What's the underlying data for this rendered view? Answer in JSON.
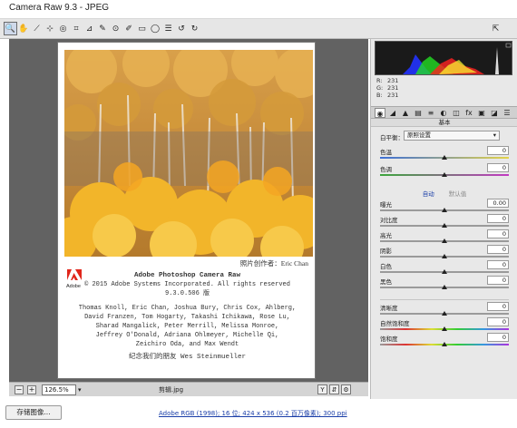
{
  "window": {
    "title": "Camera Raw 9.3 - JPEG"
  },
  "toolbar": {
    "tools": [
      {
        "icon": "zoom-icon",
        "glyph": "🔍",
        "active": true
      },
      {
        "icon": "hand-icon",
        "glyph": "✋",
        "active": false
      },
      {
        "icon": "white-balance-icon",
        "glyph": "⟋",
        "active": false
      },
      {
        "icon": "color-sampler-icon",
        "glyph": "⊹",
        "active": false
      },
      {
        "icon": "target-adjust-icon",
        "glyph": "◎",
        "active": false
      },
      {
        "icon": "crop-icon",
        "glyph": "⌗",
        "active": false
      },
      {
        "icon": "straighten-icon",
        "glyph": "⊿",
        "active": false
      },
      {
        "icon": "spot-removal-icon",
        "glyph": "✎",
        "active": false
      },
      {
        "icon": "red-eye-icon",
        "glyph": "⊙",
        "active": false
      },
      {
        "icon": "adjustment-brush-icon",
        "glyph": "✐",
        "active": false
      },
      {
        "icon": "graduated-filter-icon",
        "glyph": "▭",
        "active": false
      },
      {
        "icon": "radial-filter-icon",
        "glyph": "◯",
        "active": false
      },
      {
        "icon": "preferences-icon",
        "glyph": "☰",
        "active": false
      },
      {
        "icon": "rotate-left-icon",
        "glyph": "↺",
        "active": false
      },
      {
        "icon": "rotate-right-icon",
        "glyph": "↻",
        "active": false
      }
    ],
    "fullscreen_icon": "⇱"
  },
  "preview": {
    "credit": "照片创作者：Eric Chan",
    "about": {
      "product": "Adobe Photoshop Camera Raw",
      "copyright": "© 2015 Adobe Systems Incorporated. All rights reserved",
      "version": "9.3.0.506 版",
      "credits_lines": [
        "Thomas Knoll, Eric Chan, Joshua Bury, Chris Cox, Ahlberg,",
        "David Franzen, Tom Hogarty, Takashi Ichikawa, Rose Lu,",
        "Sharad Mangalick, Peter Merrill, Melissa Monroe,",
        "Jeffrey O'Donald, Adriana Ohlmeyer, Michelle Qi,",
        "Zeichiro Oda, and Max Wendt"
      ],
      "tribute": "纪念我们的朋友 Wes Steinmueller"
    },
    "logo_text": "Adobe"
  },
  "statusbar": {
    "zoom_value": "126.5%",
    "filename": "剪辑.jpg",
    "zoom_out_icon": "−",
    "zoom_in_icon": "+",
    "btn_a": "Y",
    "btn_b": "⇵",
    "btn_c": "⚙"
  },
  "bottom": {
    "save_label": "存储图像...",
    "workflow_link": "Adobe RGB (1998); 16 位; 424 x 536 (0.2 百万像素); 300 ppi"
  },
  "readout": {
    "r_label": "R:",
    "r": "231",
    "g_label": "G:",
    "g": "231",
    "b_label": "B:",
    "b": "231"
  },
  "panel": {
    "title": "基本",
    "tabs": [
      "◉",
      "◢",
      "▲",
      "▤",
      "≡",
      "◐",
      "◫",
      "fx",
      "▣",
      "◪",
      "☰"
    ],
    "white_balance_label": "白平衡：",
    "white_balance_value": "原照设置",
    "temp": {
      "label": "色温",
      "value": "0",
      "pos": 0.5
    },
    "tint": {
      "label": "色调",
      "value": "0",
      "pos": 0.5
    },
    "auto_label": "自动",
    "default_label": "默认值",
    "sliders": [
      {
        "label": "曝光",
        "value": "0.00",
        "pos": 0.5
      },
      {
        "label": "对比度",
        "value": "0",
        "pos": 0.5
      },
      {
        "label": "高光",
        "value": "0",
        "pos": 0.5
      },
      {
        "label": "阴影",
        "value": "0",
        "pos": 0.5
      },
      {
        "label": "白色",
        "value": "0",
        "pos": 0.5
      },
      {
        "label": "黑色",
        "value": "0",
        "pos": 0.5
      }
    ],
    "presence": [
      {
        "label": "清晰度",
        "value": "0",
        "pos": 0.5
      },
      {
        "label": "自然饱和度",
        "value": "0",
        "pos": 0.5
      },
      {
        "label": "饱和度",
        "value": "0",
        "pos": 0.5
      }
    ]
  }
}
